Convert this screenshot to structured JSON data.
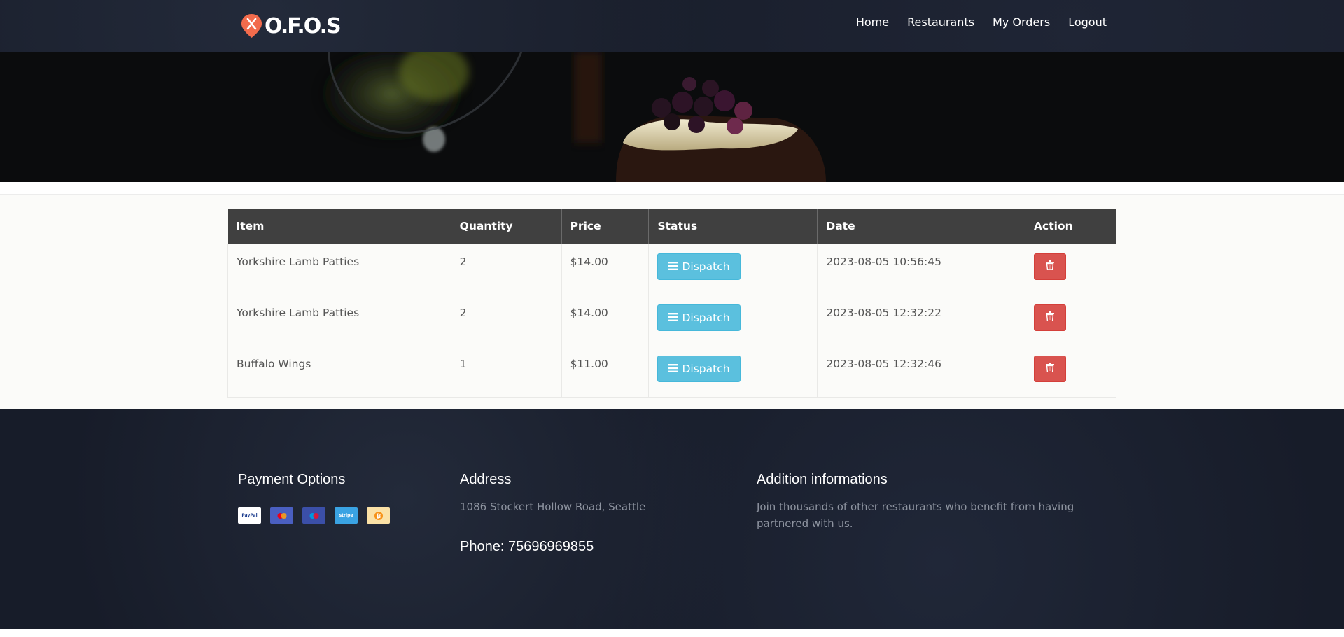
{
  "brand": {
    "name": "O.F.O.S",
    "logo_icon": "fork-knife-pin-icon",
    "accent": "#f26b4c"
  },
  "nav": {
    "links": [
      "Home",
      "Restaurants",
      "My Orders",
      "Logout"
    ]
  },
  "orders": {
    "headers": [
      "Item",
      "Quantity",
      "Price",
      "Status",
      "Date",
      "Action"
    ],
    "rows": [
      {
        "item": "Yorkshire Lamb Patties",
        "quantity": "2",
        "price": "$14.00",
        "status": "Dispatch",
        "date": "2023-08-05 10:56:45"
      },
      {
        "item": "Yorkshire Lamb Patties",
        "quantity": "2",
        "price": "$14.00",
        "status": "Dispatch",
        "date": "2023-08-05 12:32:22"
      },
      {
        "item": "Buffalo Wings",
        "quantity": "1",
        "price": "$11.00",
        "status": "Dispatch",
        "date": "2023-08-05 12:32:46"
      }
    ],
    "status_icon": "bars-icon",
    "delete_icon": "trash-icon",
    "colors": {
      "dispatch": "#5bc0de",
      "delete": "#d9534f",
      "header": "#404040"
    }
  },
  "footer": {
    "payment": {
      "title": "Payment Options",
      "methods": [
        "PayPal",
        "Mastercard",
        "Maestro",
        "stripe",
        "Bitcoin"
      ]
    },
    "address": {
      "title": "Address",
      "text": "1086 Stockert Hollow Road, Seattle",
      "phone": "Phone: 75696969855"
    },
    "info": {
      "title": "Addition informations",
      "text": "Join thousands of other restaurants who benefit from having partnered with us."
    }
  }
}
